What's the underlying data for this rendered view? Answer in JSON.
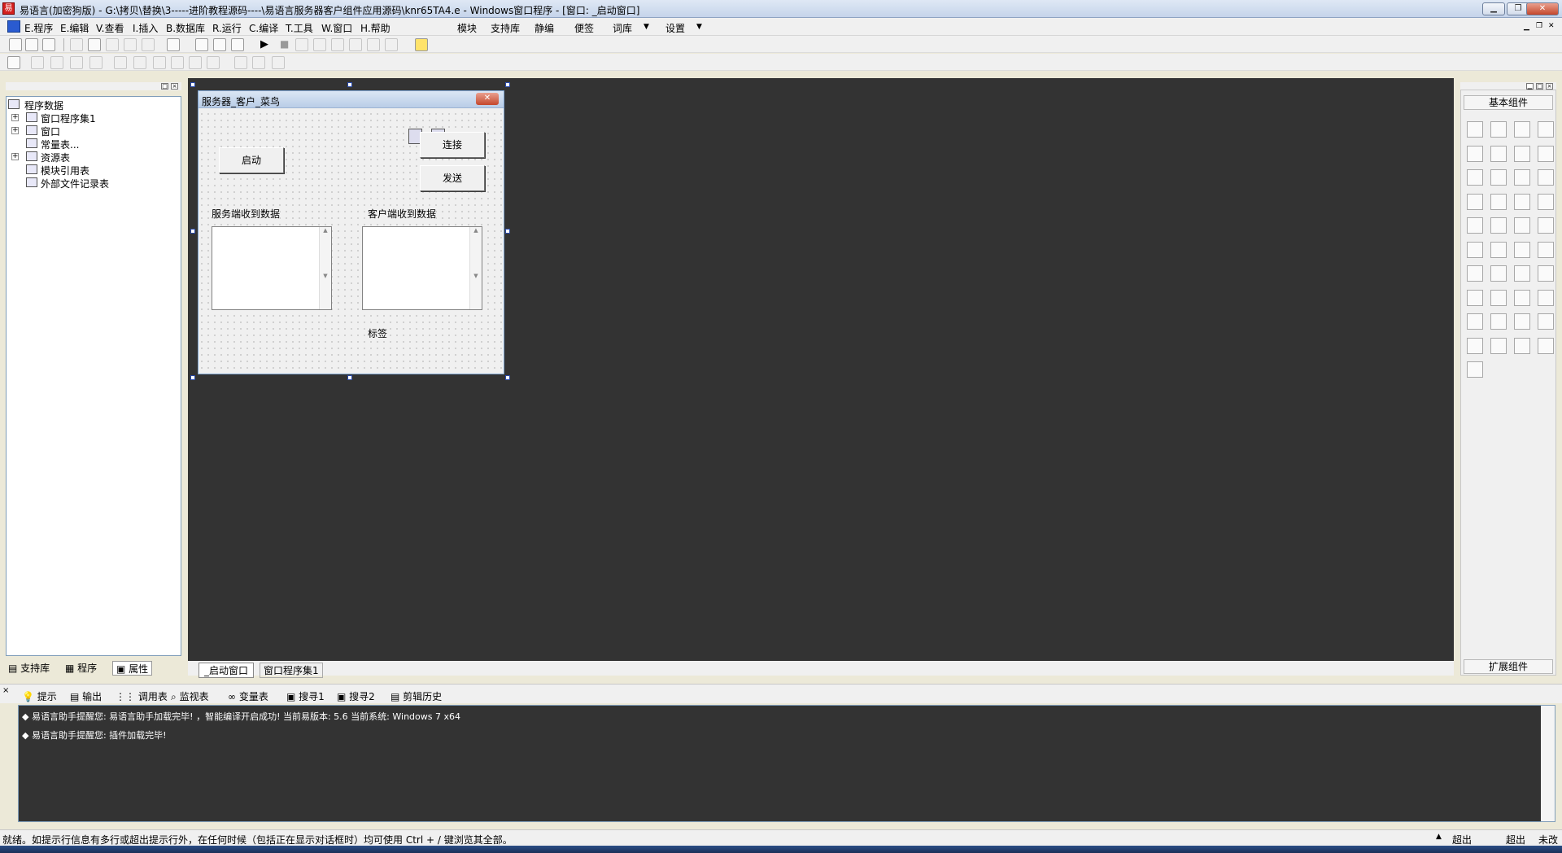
{
  "window": {
    "title": "易语言(加密狗版) - G:\\拷贝\\替换\\3-----进阶教程源码----\\易语言服务器客户组件应用源码\\knr65TA4.e - Windows窗口程序 - [窗口: _启动窗口]"
  },
  "menu": {
    "items": [
      "E.程序",
      "E.编辑",
      "V.查看",
      "I.插入",
      "B.数据库",
      "R.运行",
      "C.编译",
      "T.工具",
      "W.窗口",
      "H.帮助"
    ],
    "extra": [
      "模块",
      "支持库",
      "静编",
      "便签",
      "词库",
      "设置"
    ]
  },
  "tree": {
    "root": "程序数据",
    "items": [
      "窗口程序集1",
      "窗口",
      "常量表...",
      "资源表",
      "模块引用表",
      "外部文件记录表"
    ]
  },
  "left_tabs": [
    "支持库",
    "程序",
    "属性"
  ],
  "form": {
    "title": "服务器_客户_菜鸟",
    "start_button": "启动",
    "connect_button": "连接",
    "send_button": "发送",
    "server_label": "服务端收到数据",
    "client_label": "客户端收到数据",
    "tag_label": "标签"
  },
  "design_tabs": [
    "_启动窗口",
    "窗口程序集1"
  ],
  "palette": {
    "header": "基本组件",
    "footer": "扩展组件"
  },
  "output_tabs": [
    "提示",
    "输出",
    "调用表",
    "监视表",
    "变量表",
    "搜寻1",
    "搜寻2",
    "剪辑历史"
  ],
  "output_lines": [
    "易语言助手提醒您: 易语言助手加载完毕! ，智能编译开启成功! 当前易版本: 5.6 当前系统: Windows 7 x64",
    "易语言助手提醒您: 插件加载完毕!"
  ],
  "status": {
    "message": "就绪。如提示行信息有多行或超出提示行外，在任何时候（包括正在显示对话框时）均可使用 Ctrl + / 键浏览其全部。",
    "panes": [
      "超出",
      "超出",
      "未改"
    ]
  }
}
